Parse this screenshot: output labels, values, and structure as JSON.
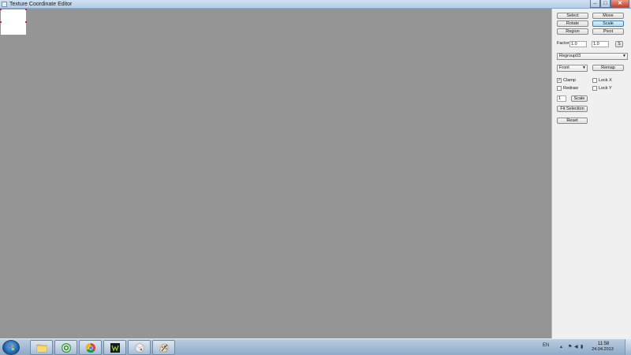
{
  "window": {
    "title": "Texture Coordinate Editor",
    "buttons": {
      "minimize": "–",
      "maximize": "□",
      "close": "✕"
    }
  },
  "panel": {
    "modes": {
      "select": "Select",
      "move": "Move",
      "rotate": "Rotate",
      "scale": "Scale",
      "region": "Region",
      "pivot": "Pivot",
      "active": "Scale"
    },
    "factor": {
      "label": "Factor",
      "x_value": "1.0",
      "y_value": "1.0",
      "lock_button": "S"
    },
    "regroup_select": {
      "value": "Regroup03"
    },
    "view_select": {
      "value": "Front"
    },
    "remap_button": "Remap",
    "options": {
      "clamp": {
        "label": "Clamp",
        "checked": true
      },
      "lock_x": {
        "label": "Lock X",
        "checked": false
      },
      "redraw": {
        "label": "Redraw",
        "checked": false
      },
      "lock_y": {
        "label": "Lock Y",
        "checked": false
      }
    },
    "scale_value": "1",
    "scale_button": "Scale",
    "fit_selection_button": "Fit Selection",
    "reset_button": "Reset"
  },
  "taskbar": {
    "apps": [
      {
        "name": "explorer",
        "icon": "folder-icon"
      },
      {
        "name": "mail-agent",
        "icon": "at-sign-icon"
      },
      {
        "name": "chrome",
        "icon": "chrome-icon"
      },
      {
        "name": "w-app",
        "icon": "w-letter-icon"
      },
      {
        "name": "app-3d",
        "icon": "cube-icon"
      },
      {
        "name": "paint",
        "icon": "paint-palette-icon"
      }
    ],
    "tray": {
      "language": "EN",
      "time": "11:58",
      "date": "24.04.2013"
    }
  },
  "colors": {
    "canvas": "#959595",
    "panel": "#f0f0f0",
    "texture": "#ffffff",
    "uv_point": "#c03030",
    "active_button": "#a9d7f3"
  }
}
